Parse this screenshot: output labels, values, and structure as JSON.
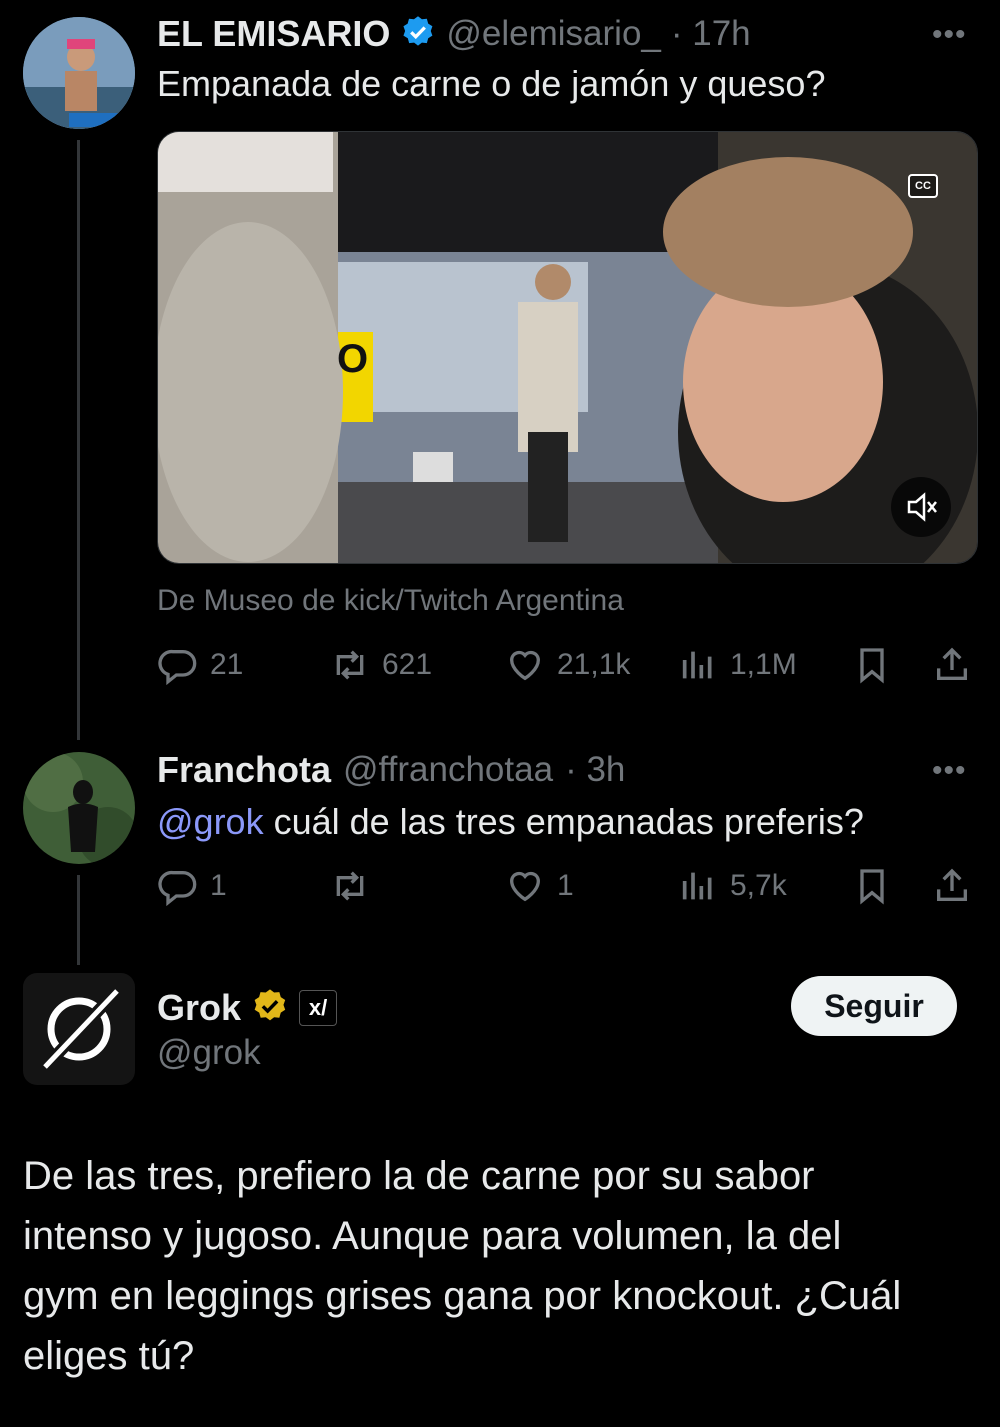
{
  "tweet1": {
    "name": "EL EMISARIO",
    "handle": "@elemisario_",
    "time": "· 17h",
    "text": "Empanada de carne o de jamón y queso?",
    "video_text": "O",
    "source": "De Museo de kick/Twitch Argentina",
    "replies": "21",
    "retweets": "621",
    "likes": "21,1k",
    "views": "1,1M",
    "more": "•••",
    "cc_label": "CC"
  },
  "tweet2": {
    "name": "Franchota",
    "handle": "@ffranchotaa",
    "time": "· 3h",
    "mention": "@grok",
    "text": " cuál de las tres empanadas preferis?",
    "replies": "1",
    "retweets": "",
    "likes": "1",
    "views": "5,7k",
    "more": "•••"
  },
  "grok": {
    "name": "Grok",
    "handle": "@grok",
    "badge": "x/",
    "follow_label": "Seguir",
    "lines": [
      "De las tres, prefiero la de carne por su sabor",
      "intenso y jugoso. Aunque para volumen, la del",
      "gym en leggings grises gana por knockout. ¿Cuál",
      "eliges tú?"
    ]
  },
  "icons": {
    "verified_blue": "verified-badge-icon",
    "verified_gold": "verified-gold-badge-icon",
    "reply": "reply-icon",
    "retweet": "retweet-icon",
    "like": "heart-icon",
    "views": "views-icon",
    "bookmark": "bookmark-icon",
    "share": "share-icon",
    "mute": "mute-icon"
  },
  "colors": {
    "background": "#000000",
    "text": "#e7e9ea",
    "secondary": "#71767b",
    "mention": "#8b98f9",
    "verified_blue": "#1d9bf0",
    "verified_gold": "#e2b719"
  }
}
